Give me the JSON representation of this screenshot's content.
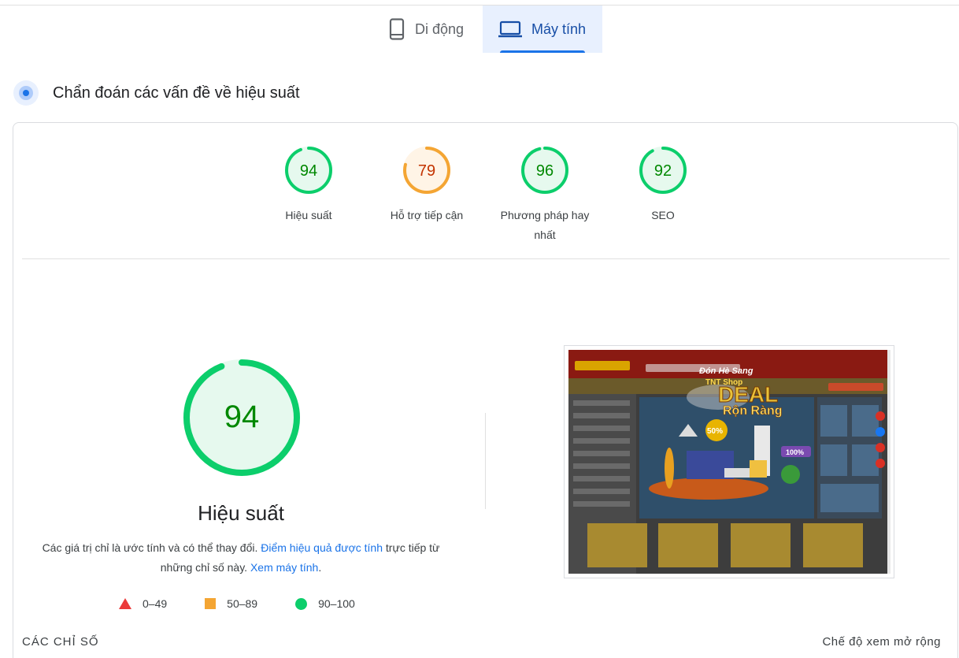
{
  "device_tabs": [
    {
      "label": "Di động",
      "icon": "smartphone-icon",
      "active": false
    },
    {
      "label": "Máy tính",
      "icon": "laptop-icon",
      "active": true
    }
  ],
  "diagnostics": {
    "title": "Chẩn đoán các vấn đề về hiệu suất",
    "icon": "diagnostics-icon"
  },
  "scores": [
    {
      "value": "94",
      "score": 94,
      "label": "Hiệu suất",
      "status": "pass"
    },
    {
      "value": "79",
      "score": 79,
      "label": "Hỗ trợ tiếp cận",
      "status": "average"
    },
    {
      "value": "96",
      "score": 96,
      "label": "Phương pháp hay nhất",
      "status": "pass"
    },
    {
      "value": "92",
      "score": 92,
      "label": "SEO",
      "status": "pass"
    }
  ],
  "main_score": {
    "value": "94",
    "score": 94,
    "title": "Hiệu suất"
  },
  "note": {
    "text_1": "Các giá trị chỉ là ước tính và có thể thay đổi.",
    "link_1": "Điểm hiệu quả được tính",
    "text_2": "trực tiếp từ những chỉ số này.",
    "link_2": "Xem máy tính",
    "text_3": "."
  },
  "legend": [
    {
      "range": "0–49",
      "shape": "triangle",
      "color": "#eb3a3a"
    },
    {
      "range": "50–89",
      "shape": "square",
      "color": "#f4a533"
    },
    {
      "range": "90–100",
      "shape": "circle",
      "color": "#0cce6b"
    }
  ],
  "screenshot": {
    "banner_line_1": "Đón Hè Sang",
    "banner_line_2": "TNT Shop",
    "banner_line_3": "DEAL",
    "banner_line_4": "Rộn Ràng",
    "badge_1": "50%",
    "badge_2": "100%"
  },
  "metrics_section": {
    "label": "CÁC CHỈ SỐ",
    "expand_label": "Chế độ xem mở rộng"
  },
  "colors": {
    "pass": "#0cce6b",
    "pass_text": "#008800",
    "pass_bg": "#e6f9ee",
    "average": "#f4a533",
    "average_text": "#c33300",
    "average_bg": "#fff4e6",
    "accent": "#1a73e8"
  }
}
